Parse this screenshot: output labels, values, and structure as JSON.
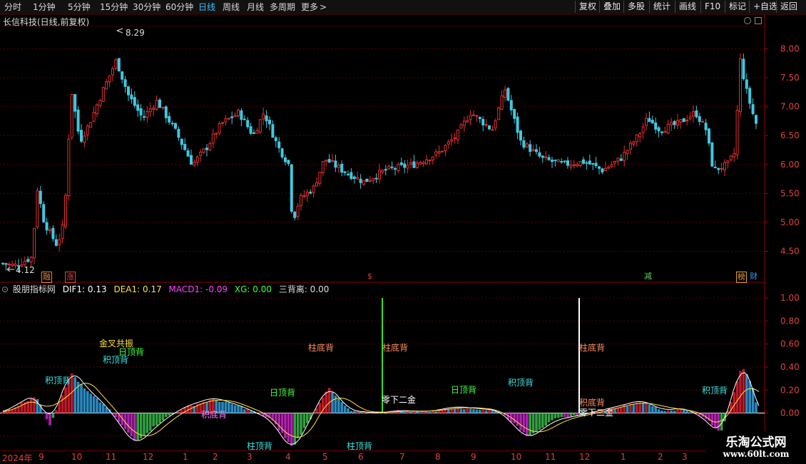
{
  "toolbar": {
    "periods": [
      {
        "label": "分时",
        "active": false
      },
      {
        "label": "1分钟",
        "active": false
      },
      {
        "label": "5分钟",
        "active": false
      },
      {
        "label": "15分钟",
        "active": false
      },
      {
        "label": "30分钟",
        "active": false
      },
      {
        "label": "60分钟",
        "active": false
      },
      {
        "label": "日线",
        "active": true
      },
      {
        "label": "周线",
        "active": false
      },
      {
        "label": "月线",
        "active": false
      },
      {
        "label": "多周期",
        "active": false
      },
      {
        "label": "更多",
        "active": false
      }
    ],
    "more_arrow": ">",
    "right_buttons": [
      "复权",
      "叠加",
      "多股",
      "统计",
      "画线",
      "F10",
      "标记",
      "+自选",
      "返回"
    ]
  },
  "stock": {
    "title": "长信科技(日线,前复权)",
    "high_marker": "8.29",
    "low_marker": "4.12"
  },
  "price_axis": {
    "labels": [
      "8.00",
      "7.50",
      "7.00",
      "6.50",
      "6.00",
      "5.50",
      "5.00",
      "4.50"
    ],
    "range": [
      4.1,
      8.35
    ]
  },
  "event_badges": [
    {
      "text": "融",
      "color": "#e08040"
    },
    {
      "text": "涨",
      "color": "#e04040"
    },
    {
      "text": "$",
      "color": "#e04040"
    },
    {
      "text": "减",
      "color": "#5fd35f"
    },
    {
      "text": "榜",
      "color": "#e0a020"
    },
    {
      "text": "财",
      "color": "#3a9af0"
    }
  ],
  "indicator": {
    "name": "股朋指标网",
    "dif1_label": "DIF1: 0.13",
    "dea1_label": "DEA1: 0.17",
    "macd1_label": "MACD1: -0.09",
    "xg_label": "XG: 0.00",
    "sbl_label": "三背离: 0.00",
    "axis_labels": [
      "1.00",
      "0.80",
      "0.60",
      "0.40",
      "0.20",
      "0.00",
      "-0.20"
    ],
    "range": [
      -0.3,
      1.05
    ],
    "signals": [
      {
        "text": "金叉共振",
        "color": "#ffe040"
      },
      {
        "text": "日顶背",
        "color": "#40ff40"
      },
      {
        "text": "积顶背",
        "color": "#40e0e0"
      },
      {
        "text": "积顶背",
        "color": "#40e0e0"
      },
      {
        "text": "积底背",
        "color": "#ff80ff"
      },
      {
        "text": "日顶背",
        "color": "#40ff40"
      },
      {
        "text": "柱顶背",
        "color": "#40e0e0"
      },
      {
        "text": "柱底背",
        "color": "#ff9060"
      },
      {
        "text": "柱底背",
        "color": "#ff9060"
      },
      {
        "text": "零下二金",
        "color": "#ffffff"
      },
      {
        "text": "柱顶背",
        "color": "#40e0e0"
      },
      {
        "text": "日顶背",
        "color": "#40ff40"
      },
      {
        "text": "积顶背",
        "color": "#40e0e0"
      },
      {
        "text": "柱底背",
        "color": "#ff9060"
      },
      {
        "text": "积底背",
        "color": "#ff9060"
      },
      {
        "text": "零下二金",
        "color": "#ffffff"
      },
      {
        "text": "积顶背",
        "color": "#40e0e0"
      }
    ]
  },
  "date_axis": {
    "labels": [
      "2024年",
      "9",
      "10",
      "11",
      "12",
      "1",
      "2",
      "3",
      "4",
      "5",
      "6",
      "7",
      "8",
      "9",
      "10",
      "11",
      "12",
      "1",
      "2",
      "3"
    ]
  },
  "watermark": {
    "line1": "乐淘公式网",
    "line2": "www.60lt.com"
  },
  "colors": {
    "up": "#e03030",
    "down": "#40c8e0",
    "background": "#000000",
    "grid": "#5a0000"
  }
}
